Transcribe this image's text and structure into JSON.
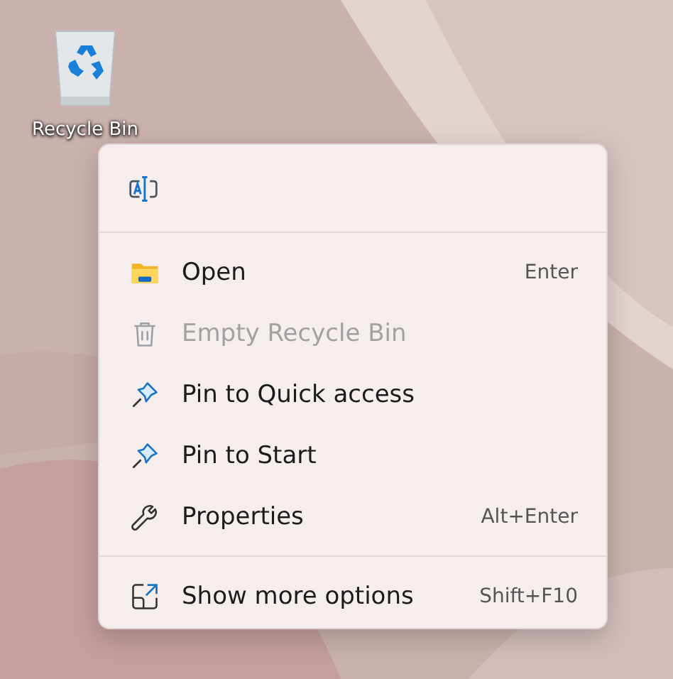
{
  "desktop_icons": [
    {
      "label": "Recycle Bin",
      "selected": false
    }
  ],
  "context_menu": {
    "sections": [
      {
        "items": [
          {
            "label": "Open",
            "shortcut": "Enter",
            "disabled": false
          },
          {
            "label": "Empty Recycle Bin",
            "disabled": true
          },
          {
            "label": "Pin to Quick access",
            "disabled": false
          },
          {
            "label": "Pin to Start",
            "disabled": false
          },
          {
            "label": "Properties",
            "shortcut": "Alt+Enter",
            "disabled": false
          }
        ]
      },
      {
        "items": [
          {
            "label": "Show more options",
            "shortcut": "Shift+F10",
            "disabled": false
          }
        ]
      }
    ]
  }
}
